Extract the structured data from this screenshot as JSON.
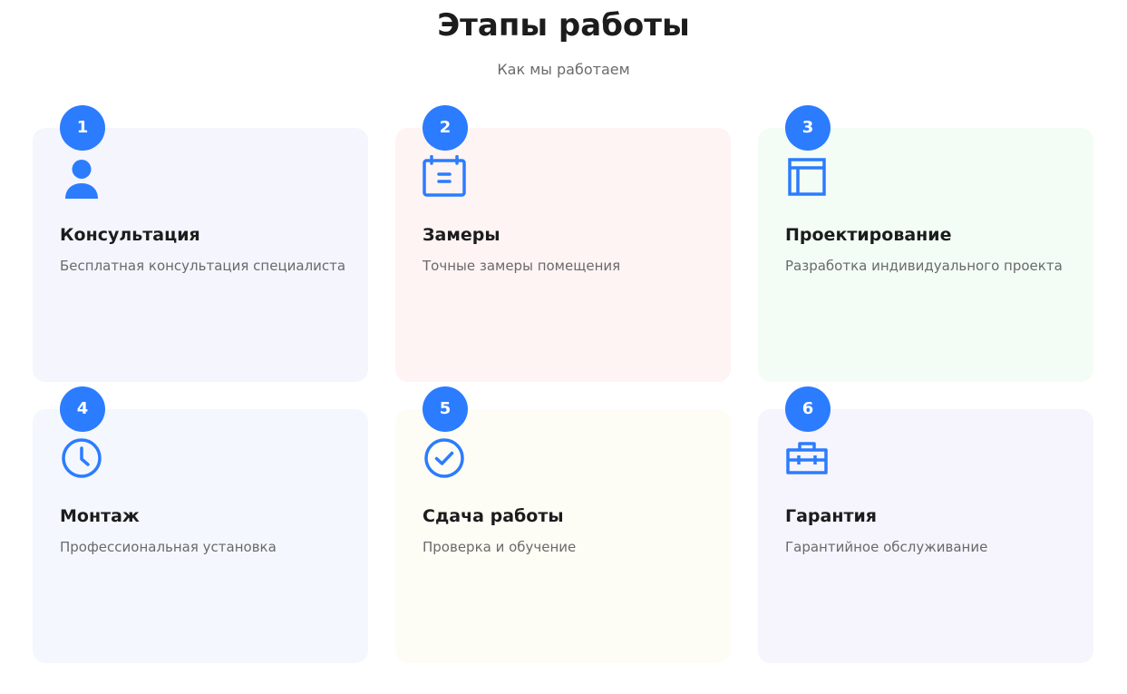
{
  "section": {
    "title": "Этапы работы",
    "subtitle": "Как мы работаем"
  },
  "colors": {
    "accent": "#2b7cff",
    "title_text": "#1c1c1c",
    "muted_text": "#6a6a6a"
  },
  "steps": [
    {
      "number": "1",
      "title": "Консультация",
      "description": "Бесплатная консультация специалиста",
      "icon": "user-icon",
      "background": "#f4f5fd"
    },
    {
      "number": "2",
      "title": "Замеры",
      "description": "Точные замеры помещения",
      "icon": "calendar-icon",
      "background": "#fef4f4"
    },
    {
      "number": "3",
      "title": "Проектирование",
      "description": "Разработка индивидуального проекта",
      "icon": "layout-icon",
      "background": "#f3fdf5"
    },
    {
      "number": "4",
      "title": "Монтаж",
      "description": "Профессиональная установка",
      "icon": "clock-icon",
      "background": "#f4f7fe"
    },
    {
      "number": "5",
      "title": "Сдача работы",
      "description": "Проверка и обучение",
      "icon": "check-circle-icon",
      "background": "#fefdf5"
    },
    {
      "number": "6",
      "title": "Гарантия",
      "description": "Гарантийное обслуживание",
      "icon": "toolbox-icon",
      "background": "#f6f4fd"
    }
  ]
}
